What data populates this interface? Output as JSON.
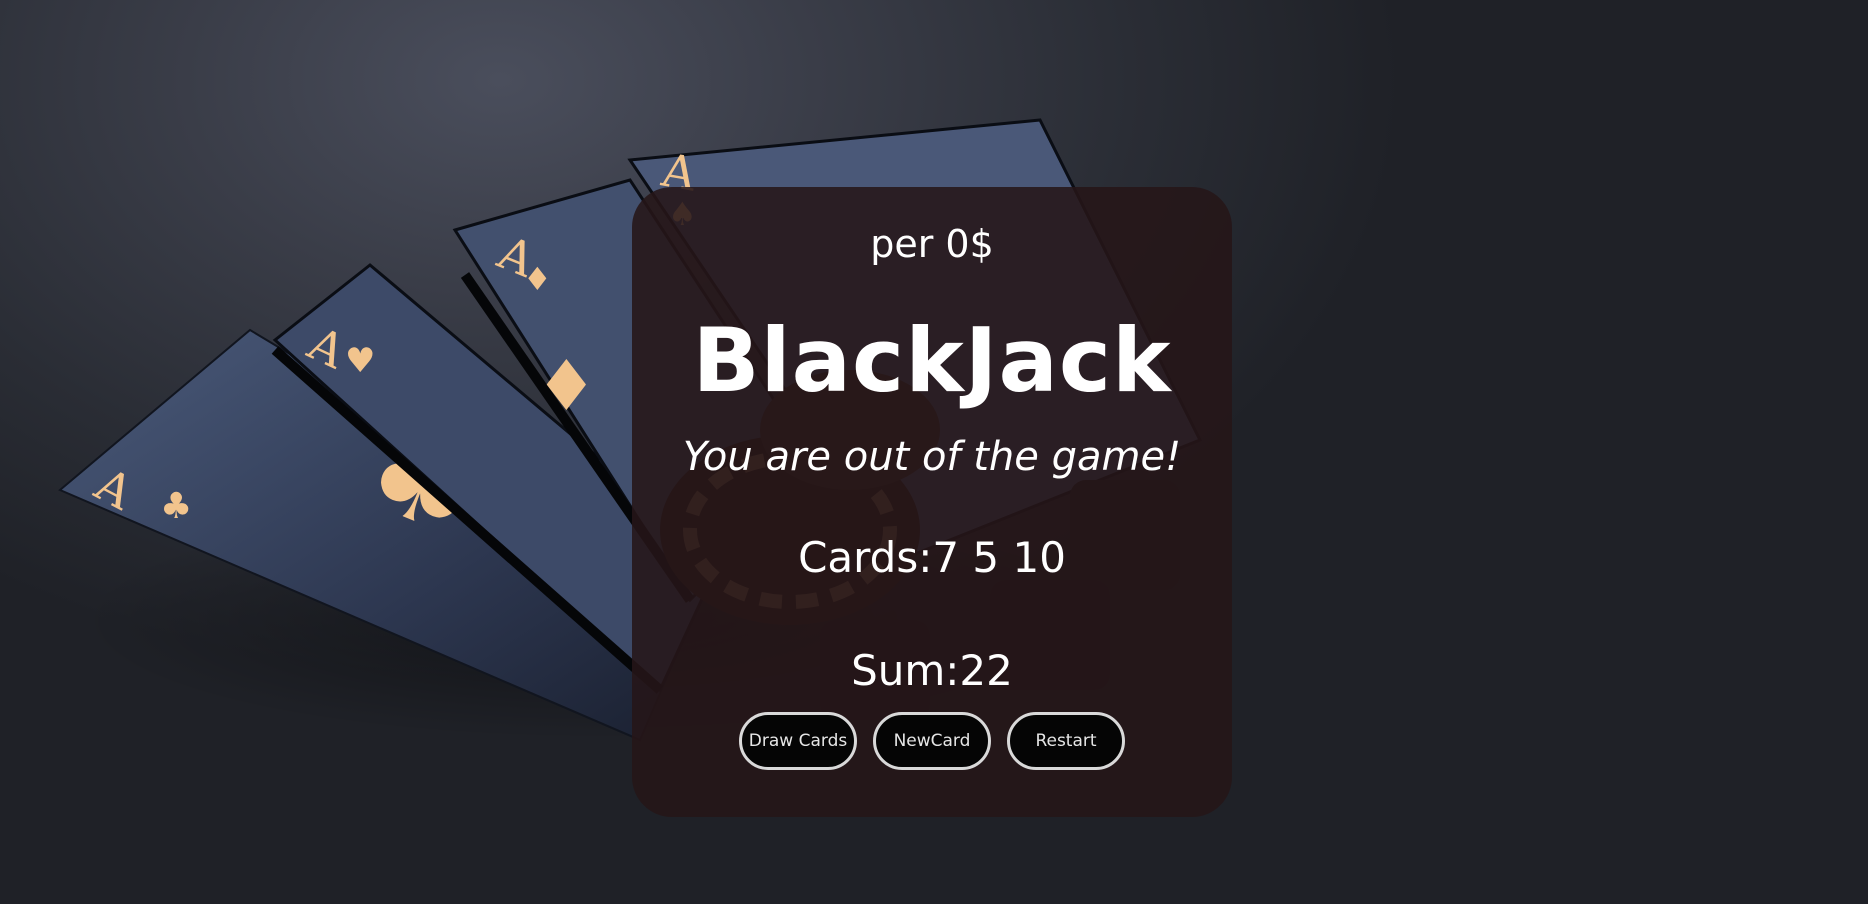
{
  "game": {
    "wallet": "per 0$",
    "title": "BlackJack",
    "message": "You are out of the game!",
    "cards_text": "Cards:7 5 10",
    "sum_text": "Sum:22"
  },
  "buttons": {
    "draw": "Draw Cards",
    "new_card": "NewCard",
    "restart": "Restart"
  },
  "colors": {
    "panel_bg": "#261618",
    "button_bg": "#050505",
    "button_border": "#d9d9d9",
    "text": "#ffffff",
    "card_accent": "#f2c48d"
  }
}
